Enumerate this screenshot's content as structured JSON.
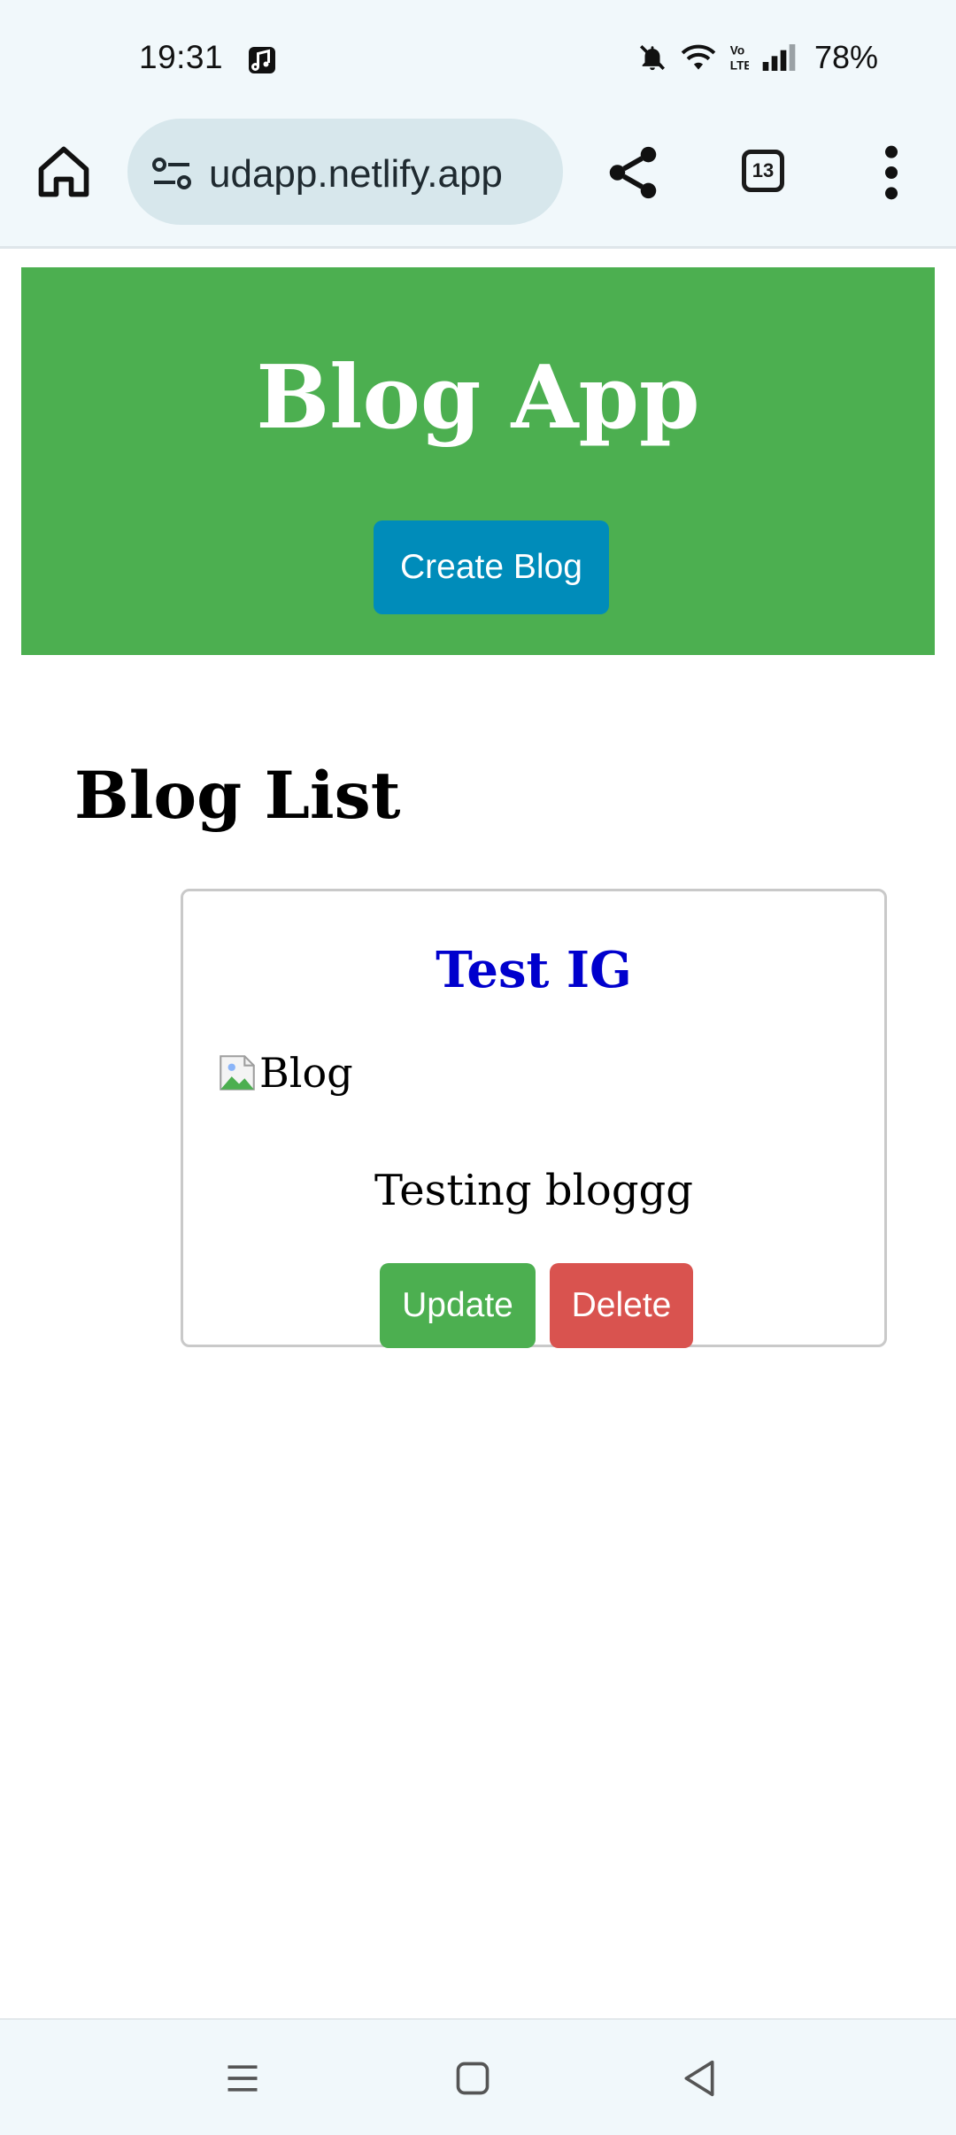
{
  "status_bar": {
    "time": "19:31",
    "battery": "78%",
    "icons": [
      "music-app-icon",
      "bell-muted-icon",
      "wifi-icon",
      "volte-icon",
      "signal-icon"
    ]
  },
  "browser": {
    "url": "udapp.netlify.app",
    "tab_count": "13",
    "icons": [
      "home-icon",
      "site-settings-icon",
      "share-icon",
      "tabs-icon",
      "more-menu-icon"
    ]
  },
  "page": {
    "app_title": "Blog App",
    "create_button": "Create Blog",
    "list_title": "Blog List",
    "blogs": [
      {
        "title": "Test IG",
        "image_alt": "Blog",
        "content": "Testing bloggg",
        "update_label": "Update",
        "delete_label": "Delete"
      }
    ]
  },
  "colors": {
    "header_bg": "#4caf50",
    "create_button_bg": "#008cba",
    "blog_title": "#0000cd",
    "update_button_bg": "#4caf50",
    "delete_button_bg": "#d9534f",
    "chrome_bg": "#f1f8fb",
    "url_pill_bg": "#d7e7ec"
  },
  "nav_bar": {
    "icons": [
      "recents-icon",
      "home-nav-icon",
      "back-icon"
    ]
  }
}
